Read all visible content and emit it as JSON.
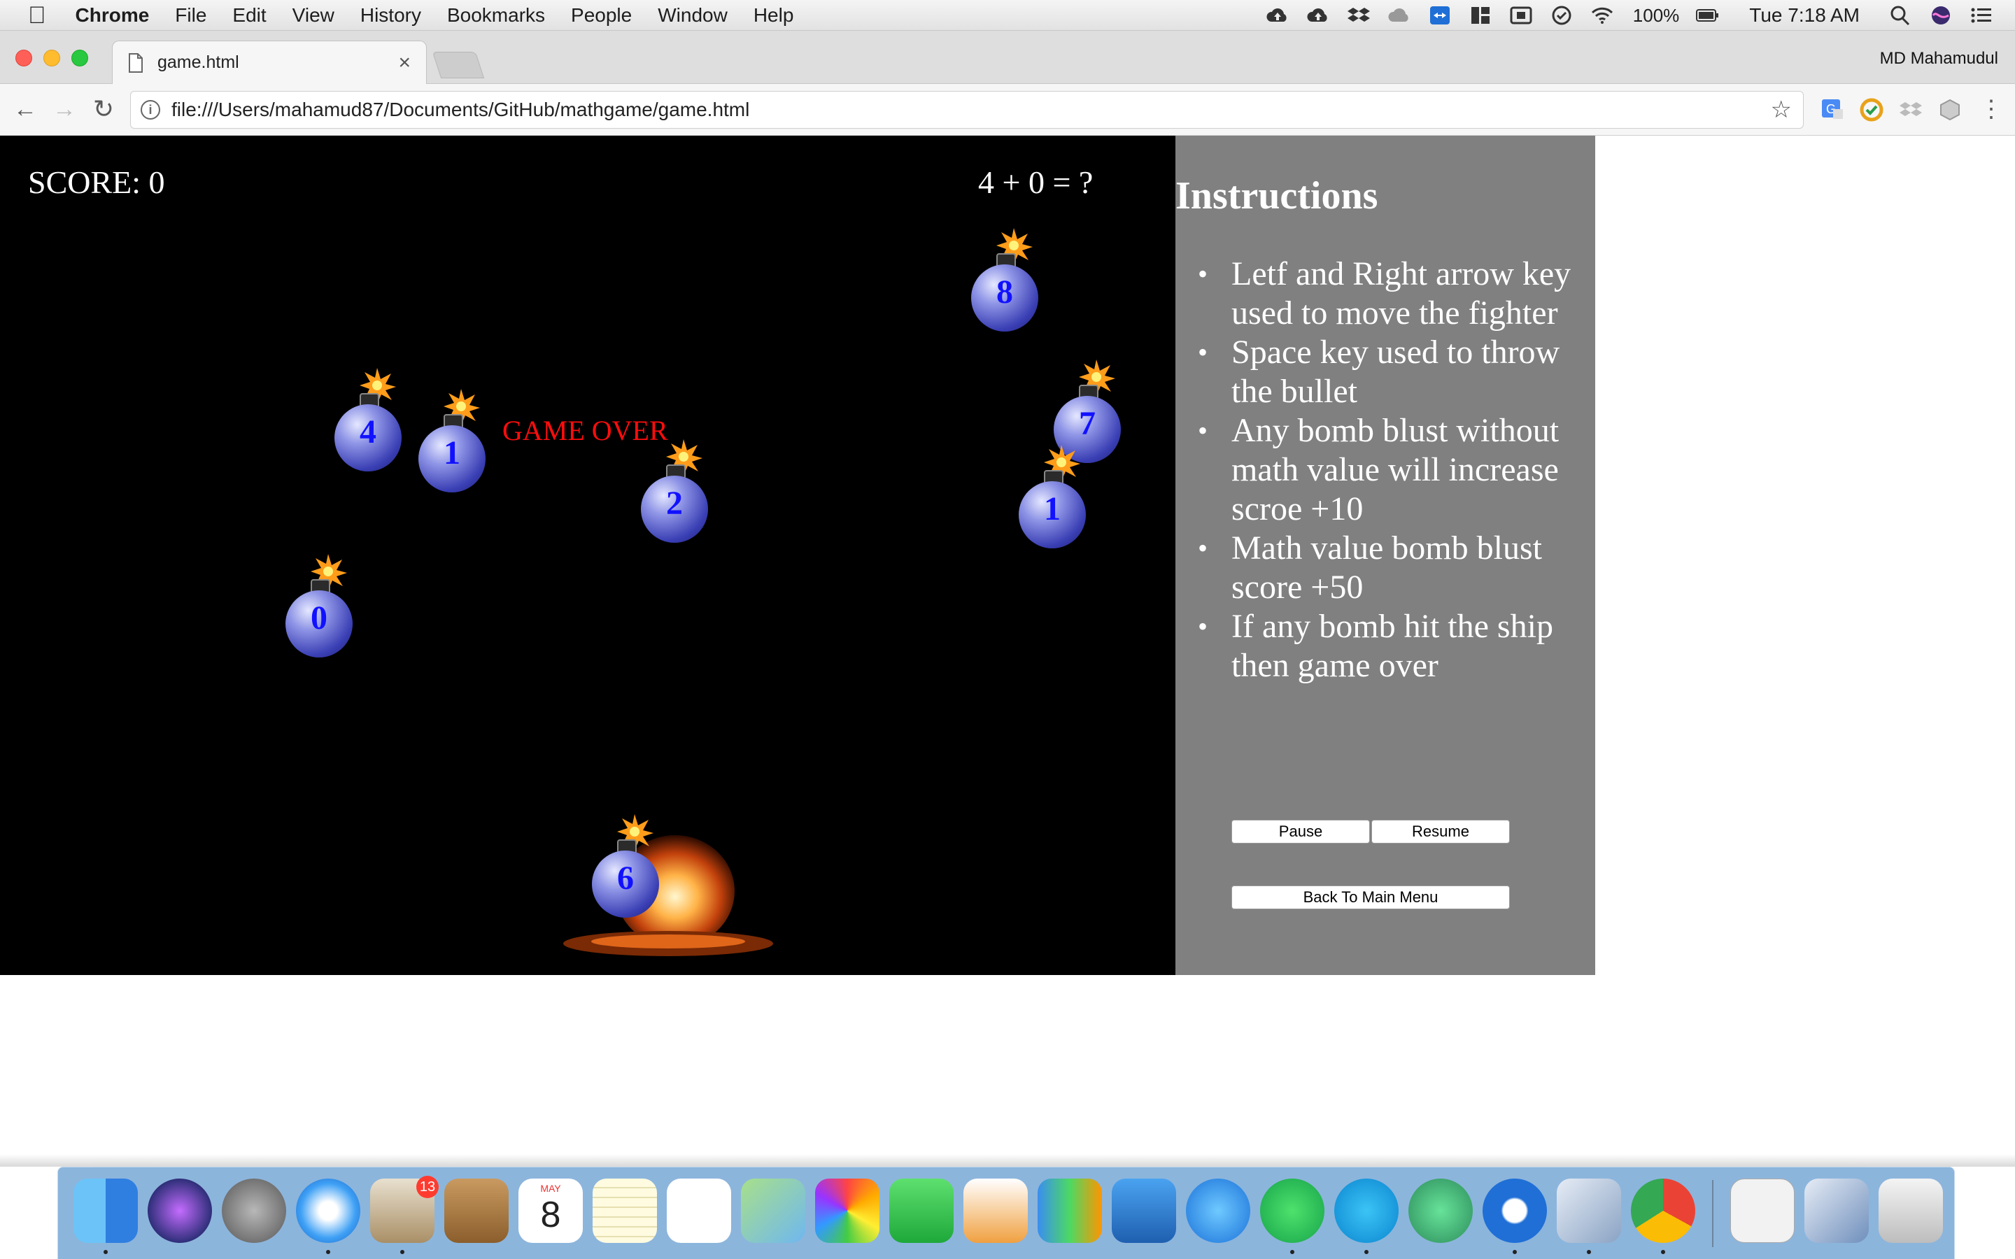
{
  "menubar": {
    "app_name": "Chrome",
    "items": [
      "File",
      "Edit",
      "View",
      "History",
      "Bookmarks",
      "People",
      "Window",
      "Help"
    ],
    "battery": "100%",
    "clock": "Tue 7:18 AM"
  },
  "tab": {
    "title": "game.html",
    "profile": "MD Mahamudul"
  },
  "toolbar": {
    "url": "file:///Users/mahamud87/Documents/GitHub/mathgame/game.html"
  },
  "game": {
    "score_text": "SCORE: 0",
    "question": "4 + 0 = ?",
    "status": "GAME OVER",
    "bombs": [
      {
        "value": "8"
      },
      {
        "value": "4"
      },
      {
        "value": "1"
      },
      {
        "value": "2"
      },
      {
        "value": "7"
      },
      {
        "value": "1"
      },
      {
        "value": "0"
      },
      {
        "value": "6"
      }
    ]
  },
  "instructions": {
    "title": "Instructions",
    "items": [
      "Letf and Right arrow key used to move the fighter",
      "Space key used to throw the bullet",
      "Any bomb blust without math value will increase scroe +10",
      "Math value bomb blust score +50",
      "If any bomb hit the ship then game over"
    ],
    "pause_label": "Pause",
    "resume_label": "Resume",
    "menu_label": "Back To Main Menu"
  },
  "dock": {
    "mail_badge": "13",
    "calendar_month": "MAY",
    "calendar_day": "8"
  },
  "colors": {
    "game_bg": "#000000",
    "panel_bg": "#808080",
    "game_over": "#ff0d0d",
    "bomb_number": "#1111ff"
  }
}
